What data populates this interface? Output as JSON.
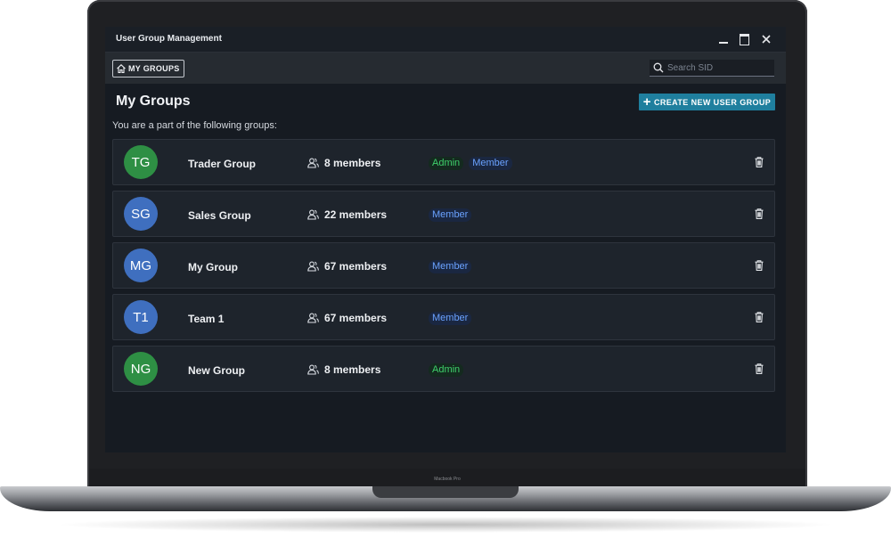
{
  "window": {
    "title": "User Group Management"
  },
  "toolbar": {
    "my_groups_label": "MY GROUPS",
    "search_placeholder": "Search SID"
  },
  "main": {
    "title": "My Groups",
    "create_button_label": "CREATE NEW USER GROUP",
    "subtitle": "You are a part of the following groups:"
  },
  "groups": [
    {
      "initials": "TG",
      "name": "Trader Group",
      "members": "8 members",
      "avatar_color": "#2e8f44",
      "badges": [
        "Admin",
        "Member"
      ]
    },
    {
      "initials": "SG",
      "name": "Sales Group",
      "members": "22 members",
      "avatar_color": "#3f6fbf",
      "badges": [
        "Member"
      ]
    },
    {
      "initials": "MG",
      "name": "My Group",
      "members": "67 members",
      "avatar_color": "#3f6fbf",
      "badges": [
        "Member"
      ]
    },
    {
      "initials": "T1",
      "name": "Team 1",
      "members": "67 members",
      "avatar_color": "#3f6fbf",
      "badges": [
        "Member"
      ]
    },
    {
      "initials": "NG",
      "name": "New Group",
      "members": "8 members",
      "avatar_color": "#2e8f44",
      "badges": [
        "Admin"
      ]
    }
  ],
  "device": {
    "label": "Macbook Pro"
  },
  "colors": {
    "accent": "#1f7f9e",
    "admin": "#3fd06b",
    "member": "#6aa2ff",
    "background": "#161b22"
  }
}
